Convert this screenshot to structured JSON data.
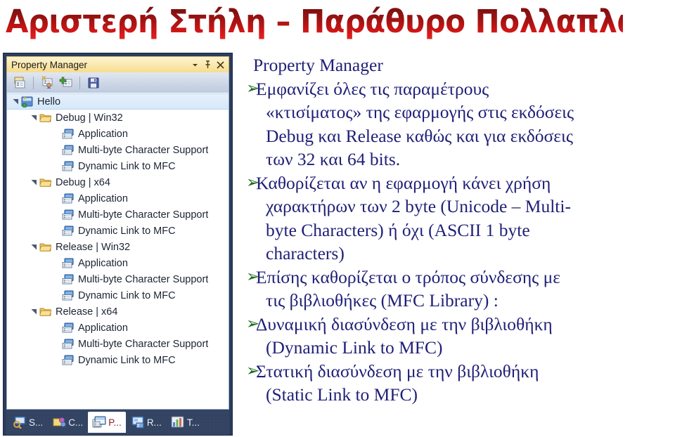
{
  "slide": {
    "title": "Αριστερή Στήλη – Παράθυρο Πολλαπλών Σελίδων",
    "title_color_top": "#7b1010",
    "title_color_bottom": "#d01616"
  },
  "panel": {
    "title": "Property Manager",
    "titlebar_controls": [
      {
        "name": "chevron-down-icon",
        "glyph": "▼"
      },
      {
        "name": "pin-icon",
        "glyph": "⚲"
      },
      {
        "name": "close-icon",
        "glyph": "✕"
      }
    ],
    "toolbar": [
      {
        "name": "view-property-pages-icon",
        "tooltip": "Property Pages"
      },
      {
        "name": "add-new-project-property-sheet-icon",
        "tooltip": "Add New Project Property Sheet"
      },
      {
        "name": "add-existing-property-sheet-icon",
        "tooltip": "Add Existing Property Sheet"
      },
      {
        "name": "save-icon",
        "tooltip": "Save"
      }
    ],
    "tree": [
      {
        "label": "Hello",
        "level": 0,
        "icon": "solution-icon",
        "expandable": true,
        "selected": true
      },
      {
        "label": "Debug | Win32",
        "level": 1,
        "icon": "folder-icon",
        "expandable": true,
        "selected": false
      },
      {
        "label": "Application",
        "level": 2,
        "icon": "property-sheet-icon",
        "expandable": false,
        "selected": false
      },
      {
        "label": "Multi-byte Character Support",
        "level": 2,
        "icon": "property-sheet-icon",
        "expandable": false,
        "selected": false
      },
      {
        "label": "Dynamic Link to MFC",
        "level": 2,
        "icon": "property-sheet-icon",
        "expandable": false,
        "selected": false
      },
      {
        "label": "Debug | x64",
        "level": 1,
        "icon": "folder-icon",
        "expandable": true,
        "selected": false
      },
      {
        "label": "Application",
        "level": 2,
        "icon": "property-sheet-icon",
        "expandable": false,
        "selected": false
      },
      {
        "label": "Multi-byte Character Support",
        "level": 2,
        "icon": "property-sheet-icon",
        "expandable": false,
        "selected": false
      },
      {
        "label": "Dynamic Link to MFC",
        "level": 2,
        "icon": "property-sheet-icon",
        "expandable": false,
        "selected": false
      },
      {
        "label": "Release | Win32",
        "level": 1,
        "icon": "folder-icon",
        "expandable": true,
        "selected": false
      },
      {
        "label": "Application",
        "level": 2,
        "icon": "property-sheet-icon",
        "expandable": false,
        "selected": false
      },
      {
        "label": "Multi-byte Character Support",
        "level": 2,
        "icon": "property-sheet-icon",
        "expandable": false,
        "selected": false
      },
      {
        "label": "Dynamic Link to MFC",
        "level": 2,
        "icon": "property-sheet-icon",
        "expandable": false,
        "selected": false
      },
      {
        "label": "Release | x64",
        "level": 1,
        "icon": "folder-icon",
        "expandable": true,
        "selected": false
      },
      {
        "label": "Application",
        "level": 2,
        "icon": "property-sheet-icon",
        "expandable": false,
        "selected": false
      },
      {
        "label": "Multi-byte Character Support",
        "level": 2,
        "icon": "property-sheet-icon",
        "expandable": false,
        "selected": false
      },
      {
        "label": "Dynamic Link to MFC",
        "level": 2,
        "icon": "property-sheet-icon",
        "expandable": false,
        "selected": false
      }
    ],
    "tabs": [
      {
        "label": "S...",
        "icon": "solution-explorer-icon",
        "active": false
      },
      {
        "label": "C...",
        "icon": "class-view-icon",
        "active": false
      },
      {
        "label": "P...",
        "icon": "property-manager-icon",
        "active": true
      },
      {
        "label": "R...",
        "icon": "resource-view-icon",
        "active": false
      },
      {
        "label": "T...",
        "icon": "team-explorer-icon",
        "active": false
      }
    ]
  },
  "content": {
    "lines": [
      {
        "text": "Property Manager",
        "bullet": false,
        "cont": false
      },
      {
        "text": "Εμφανίζει όλες τις παραμέτρους",
        "bullet": true,
        "cont": false
      },
      {
        "text": "«κτισίματος» της εφαρμογής στις εκδόσεις",
        "bullet": false,
        "cont": true
      },
      {
        "text": "Debug και Release καθώς και για εκδόσεις",
        "bullet": false,
        "cont": true
      },
      {
        "text": "των 32 και 64 bits.",
        "bullet": false,
        "cont": true
      },
      {
        "text": "Καθορίζεται αν η εφαρμογή κάνει χρήση",
        "bullet": true,
        "cont": false
      },
      {
        "text": "χαρακτήρων των 2 byte (Unicode – Multi-",
        "bullet": false,
        "cont": true
      },
      {
        "text": "byte Characters) ή όχι (ASCII 1 byte",
        "bullet": false,
        "cont": true
      },
      {
        "text": "characters)",
        "bullet": false,
        "cont": true
      },
      {
        "text": "Επίσης καθορίζεται ο τρόπος σύνδεσης με",
        "bullet": true,
        "cont": false
      },
      {
        "text": "τις βιβλιοθήκες (MFC Library) :",
        "bullet": false,
        "cont": true
      },
      {
        "text": "Δυναμική διασύνδεση με την βιβλιοθήκη",
        "bullet": true,
        "cont": false
      },
      {
        "text": "(Dynamic Link to MFC)",
        "bullet": false,
        "cont": true
      },
      {
        "text": "Στατική διασύνδεση με την βιβλιοθήκη",
        "bullet": true,
        "cont": false
      },
      {
        "text": "(Static Link to MFC)",
        "bullet": false,
        "cont": true
      }
    ],
    "bullet_glyph": "➢",
    "text_color": "#1f1f78",
    "bullet_color": "#1d6b1d"
  }
}
